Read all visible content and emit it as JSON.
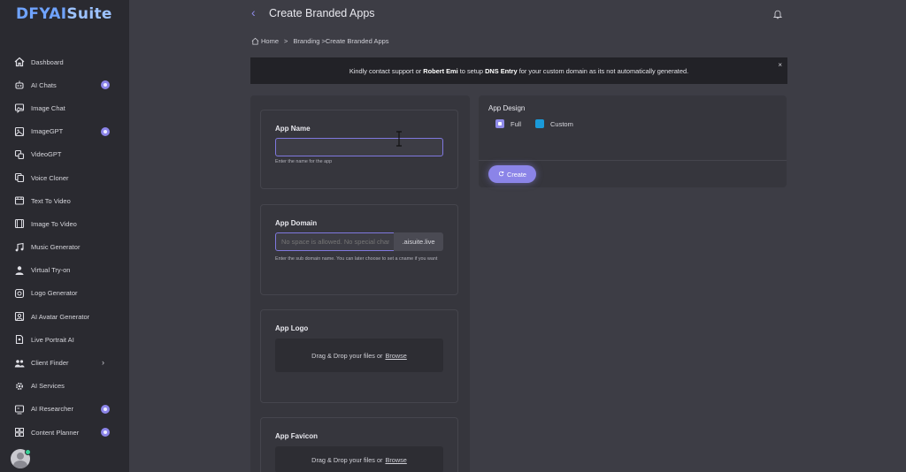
{
  "app": {
    "logo_primary": "DFYAI",
    "logo_secondary": "Suite"
  },
  "sidebar": {
    "items": [
      {
        "label": "Dashboard",
        "icon": "home-icon"
      },
      {
        "label": "AI Chats",
        "icon": "robot-icon",
        "badge": true
      },
      {
        "label": "Image Chat",
        "icon": "image-chat-icon"
      },
      {
        "label": "ImageGPT",
        "icon": "image-icon",
        "badge": true
      },
      {
        "label": "VideoGPT",
        "icon": "video-icon"
      },
      {
        "label": "Voice Cloner",
        "icon": "copy-icon"
      },
      {
        "label": "Text To Video",
        "icon": "film-icon"
      },
      {
        "label": "Image To Video",
        "icon": "film-strip-icon"
      },
      {
        "label": "Music Generator",
        "icon": "music-icon"
      },
      {
        "label": "Virtual Try-on",
        "icon": "person-icon"
      },
      {
        "label": "Logo Generator",
        "icon": "logo-icon"
      },
      {
        "label": "AI Avatar Generator",
        "icon": "avatar-icon"
      },
      {
        "label": "Live Portrait AI",
        "icon": "portrait-icon"
      },
      {
        "label": "Client Finder",
        "icon": "users-icon",
        "chevron": true
      },
      {
        "label": "AI Services",
        "icon": "gear-icon"
      },
      {
        "label": "AI Researcher",
        "icon": "research-icon",
        "badge": true
      },
      {
        "label": "Content Planner",
        "icon": "grid-icon",
        "badge": true
      }
    ]
  },
  "header": {
    "back_icon": "‹",
    "title": "Create Branded Apps"
  },
  "breadcrumb": {
    "home": "Home",
    "sep": ">",
    "branding": "Branding",
    "current": ">Create Branded Apps"
  },
  "banner": {
    "text_1": "Kindly contact support or ",
    "name": "Robert Emi",
    "text_2": " to setup ",
    "dns": "DNS Entry",
    "text_3": " for your custom domain as its not automatically generated.",
    "close": "×"
  },
  "form": {
    "app_name": {
      "label": "App Name",
      "value": "",
      "helper": "Enter the name for the app"
    },
    "app_domain": {
      "label": "App Domain",
      "placeholder": "No space is allowed. No special characters",
      "suffix": ".aisuite.live",
      "helper": "Enter the sub domain name. You can later choose to set a cname if you want"
    },
    "app_logo": {
      "label": "App Logo",
      "drop_text": "Drag & Drop your files or",
      "browse": "Browse"
    },
    "app_favicon": {
      "label": "App Favicon",
      "drop_text": "Drag & Drop your files or",
      "browse": "Browse"
    }
  },
  "design": {
    "title": "App Design",
    "options": [
      {
        "label": "Full",
        "selected": true,
        "color": "#8f8be9"
      },
      {
        "label": "Custom",
        "selected": false,
        "color": "#1a9ad9"
      }
    ],
    "create_label": "Create"
  },
  "colors": {
    "accent": "#8b84e8",
    "sidebar_bg": "#2a2a30",
    "page_bg": "#3d3d45"
  }
}
